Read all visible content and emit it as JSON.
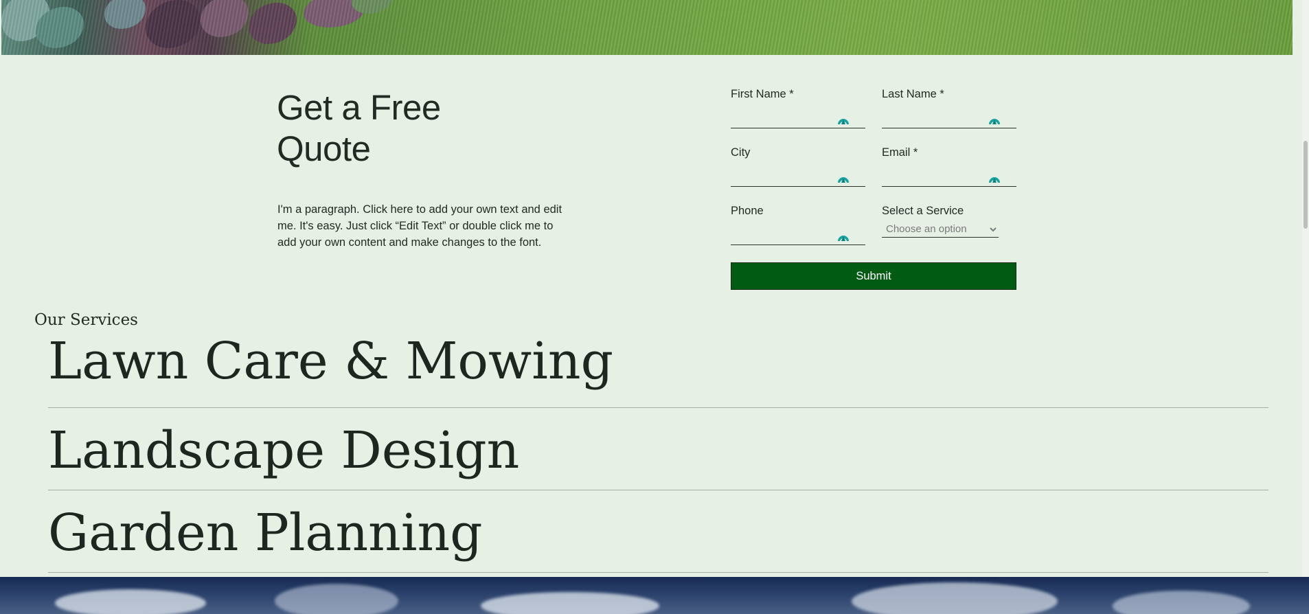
{
  "quote": {
    "title_line1": "Get a Free",
    "title_line2": "Quote",
    "paragraph": "I'm a paragraph. Click here to add your own text and edit me. It's easy. Just click “Edit Text” or double click me to add your own content and make changes to the font."
  },
  "form": {
    "first_name_label": "First Name *",
    "last_name_label": "Last Name *",
    "city_label": "City",
    "email_label": "Email *",
    "phone_label": "Phone",
    "service_label": "Select a Service",
    "service_placeholder": "Choose an option",
    "submit_label": "Submit",
    "autofill_icon": "password-manager-autofill-icon",
    "autofill_color": "#17a3a0"
  },
  "services": {
    "heading": "Our Services",
    "items": [
      "Lawn Care & Mowing",
      "Landscape Design",
      "Garden Planning"
    ]
  },
  "colors": {
    "background": "#e6f0e5",
    "button": "#025b13",
    "text": "#232a24"
  }
}
